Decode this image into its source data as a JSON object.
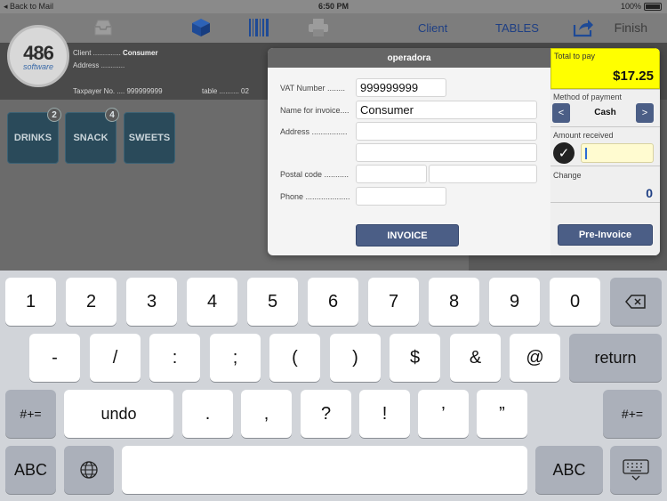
{
  "status_bar": {
    "back_label": "Back to Mail",
    "time": "6:50 PM",
    "battery": "100%"
  },
  "toolbar": {
    "icons": [
      "inbox-icon",
      "box-icon",
      "barcode-icon",
      "printer-icon",
      "share-icon"
    ],
    "client_label": "Client",
    "tables_label": "TABLES",
    "finish_label": "Finish",
    "accent_color": "#1e3f84"
  },
  "header": {
    "logo_number": "486",
    "logo_sub": "software",
    "client_label": "Client ..............",
    "client_value": "Consumer",
    "address_label": "Address ............",
    "taxpayer_label": "Taxpayer No. ....",
    "taxpayer_value": "999999999",
    "table_label": "table ..........",
    "table_value": "02"
  },
  "categories": [
    {
      "label": "DRINKS",
      "badge": "2"
    },
    {
      "label": "SNACK",
      "badge": "4"
    },
    {
      "label": "SWEETS",
      "badge": ""
    }
  ],
  "modal": {
    "title": "operadora",
    "vat_label": "VAT Number ........",
    "vat_value": "999999999",
    "name_label": "Name for invoice....",
    "name_value": "Consumer",
    "address_label": "Address ................",
    "postal_label": "Postal code ...........",
    "phone_label": "Phone ....................",
    "invoice_button": "INVOICE",
    "preinvoice_button": "Pre-Invoice"
  },
  "payment": {
    "total_label": "Total to pay",
    "total_value": "$17.25",
    "method_label": "Method of payment",
    "method_value": "Cash",
    "prev_label": "<",
    "next_label": ">",
    "received_label": "Amount received",
    "change_label": "Change",
    "change_value": "0",
    "highlight_color": "#ffff00"
  },
  "keyboard": {
    "row1": [
      "1",
      "2",
      "3",
      "4",
      "5",
      "6",
      "7",
      "8",
      "9",
      "0"
    ],
    "row2": [
      "-",
      "/",
      ":",
      ";",
      "(",
      ")",
      "$",
      "&",
      "@"
    ],
    "row3": [
      ".",
      ",",
      "?",
      "!",
      "’",
      "”"
    ],
    "return_label": "return",
    "undo_label": "undo",
    "symbols_label": "#+=",
    "abc_label": "ABC"
  }
}
